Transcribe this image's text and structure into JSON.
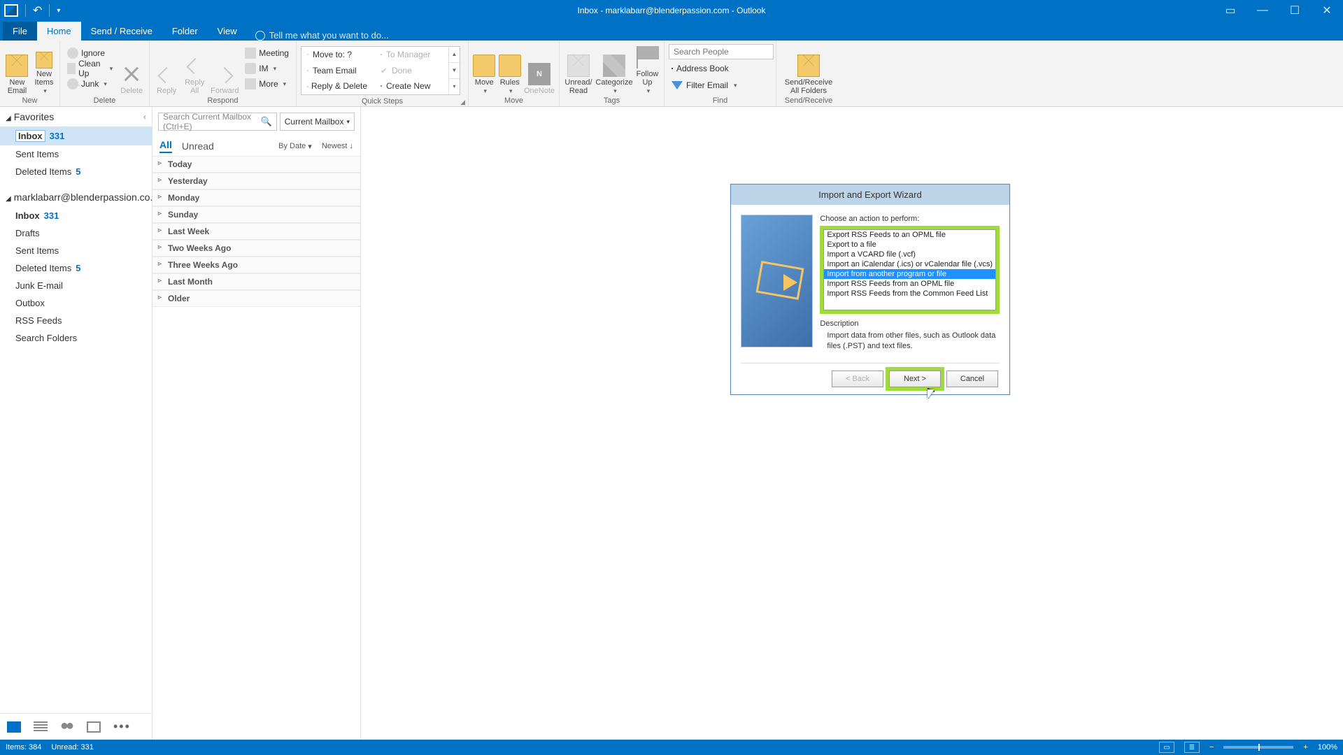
{
  "titlebar": {
    "title": "Inbox - marklabarr@blenderpassion.com - Outlook"
  },
  "ribbon_tabs": {
    "file": "File",
    "home": "Home",
    "send_receive": "Send / Receive",
    "folder": "Folder",
    "view": "View",
    "tell_me": "Tell me what you want to do..."
  },
  "ribbon": {
    "new": {
      "new_email": "New\nEmail",
      "new_items": "New\nItems",
      "label": "New"
    },
    "delete": {
      "ignore": "Ignore",
      "clean_up": "Clean Up",
      "junk": "Junk",
      "delete": "Delete",
      "label": "Delete"
    },
    "respond": {
      "reply": "Reply",
      "reply_all": "Reply\nAll",
      "forward": "Forward",
      "meeting": "Meeting",
      "im": "IM",
      "more": "More",
      "label": "Respond"
    },
    "quick_steps": {
      "move_to": "Move to: ?",
      "team_email": "Team Email",
      "reply_delete": "Reply & Delete",
      "to_manager": "To Manager",
      "done": "Done",
      "create_new": "Create New",
      "label": "Quick Steps"
    },
    "move": {
      "move": "Move",
      "rules": "Rules",
      "onenote": "OneNote",
      "label": "Move"
    },
    "tags": {
      "unread": "Unread/\nRead",
      "categorize": "Categorize",
      "follow_up": "Follow\nUp",
      "label": "Tags"
    },
    "find": {
      "search_placeholder": "Search People",
      "address_book": "Address Book",
      "filter_email": "Filter Email",
      "label": "Find"
    },
    "send_receive": {
      "btn": "Send/Receive\nAll Folders",
      "label": "Send/Receive"
    }
  },
  "nav": {
    "favorites": "Favorites",
    "fav_items": [
      {
        "name": "Inbox",
        "count": "331",
        "bold": true,
        "active": true
      },
      {
        "name": "Sent Items",
        "count": ""
      },
      {
        "name": "Deleted Items",
        "count": "5"
      }
    ],
    "account": "marklabarr@blenderpassion.co...",
    "acct_items": [
      {
        "name": "Inbox",
        "count": "331",
        "bold": true
      },
      {
        "name": "Drafts",
        "count": ""
      },
      {
        "name": "Sent Items",
        "count": ""
      },
      {
        "name": "Deleted Items",
        "count": "5"
      },
      {
        "name": "Junk E-mail",
        "count": ""
      },
      {
        "name": "Outbox",
        "count": ""
      },
      {
        "name": "RSS Feeds",
        "count": ""
      },
      {
        "name": "Search Folders",
        "count": ""
      }
    ]
  },
  "list": {
    "search_placeholder": "Search Current Mailbox (Ctrl+E)",
    "scope": "Current Mailbox",
    "all": "All",
    "unread": "Unread",
    "by_date": "By Date",
    "newest": "Newest",
    "groups": [
      "Today",
      "Yesterday",
      "Monday",
      "Sunday",
      "Last Week",
      "Two Weeks Ago",
      "Three Weeks Ago",
      "Last Month",
      "Older"
    ]
  },
  "dialog": {
    "title": "Import and Export Wizard",
    "prompt": "Choose an action to perform:",
    "actions": [
      "Export RSS Feeds to an OPML file",
      "Export to a file",
      "Import a VCARD file (.vcf)",
      "Import an iCalendar (.ics) or vCalendar file (.vcs)",
      "Import from another program or file",
      "Import RSS Feeds from an OPML file",
      "Import RSS Feeds from the Common Feed List"
    ],
    "selected_index": 4,
    "desc_label": "Description",
    "desc_text": "Import data from other files, such as Outlook data files (.PST) and text files.",
    "back": "< Back",
    "next": "Next >",
    "cancel": "Cancel"
  },
  "status": {
    "items": "Items: 384",
    "unread": "Unread: 331",
    "zoom": "100%"
  }
}
